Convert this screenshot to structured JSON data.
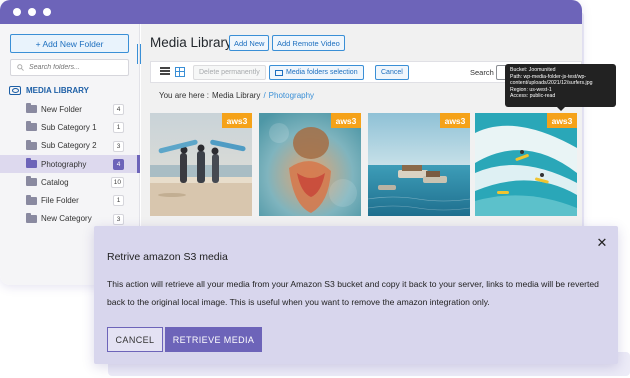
{
  "sidebar": {
    "add_folder_label": "+ Add New Folder",
    "search_placeholder": "Search folders...",
    "media_library_label": "MEDIA LIBRARY",
    "folders": [
      {
        "name": "New Folder",
        "count": "4"
      },
      {
        "name": "Sub Category 1",
        "count": "1"
      },
      {
        "name": "Sub Category 2",
        "count": "3"
      },
      {
        "name": "Photography",
        "count": "4",
        "active": true
      },
      {
        "name": "Catalog",
        "count": "10"
      },
      {
        "name": "File Folder",
        "count": "1"
      },
      {
        "name": "New Category",
        "count": "3"
      }
    ]
  },
  "main": {
    "title": "Media Library",
    "add_new_label": "Add New",
    "add_remote_label": "Add Remote Video",
    "toolbar": {
      "delete_label": "Delete permanently",
      "folders_selection_label": "Media folders selection",
      "cancel_label": "Cancel",
      "search_label": "Search"
    },
    "breadcrumb": {
      "prefix": "You are here :",
      "root": "Media Library",
      "separator": "/",
      "current": "Photography"
    },
    "thumbnails": [
      {
        "badge": "aws3",
        "subject": "surfers-beach-photo"
      },
      {
        "badge": "aws3",
        "subject": "underwater-swimmer-photo"
      },
      {
        "badge": "aws3",
        "subject": "boats-on-sea-photo"
      },
      {
        "badge": "aws3",
        "subject": "surfers-waves-photo"
      }
    ]
  },
  "tooltip": {
    "lines": [
      "Bucket: Joomunited",
      "Path: wp-media-folder-js-test/wp-",
      "content/uploads/2021/12/surfers.jpg",
      "Region: us-west-1",
      "Access: public-read"
    ]
  },
  "modal": {
    "title": "Retrive amazon S3 media",
    "body": "This action will retrieve all your media from your Amazon S3 bucket and copy it back to your server, links to media will be reverted back to the original local image. This is useful when you want to remove the amazon integration only.",
    "cancel_label": "CANCEL",
    "retrieve_label": "RETRIEVE MEDIA",
    "close_glyph": "✕"
  },
  "colors": {
    "accent": "#6d64b9",
    "link": "#3a8fd6",
    "badge": "#f5a219",
    "modal_bg": "#d8d6ed"
  }
}
